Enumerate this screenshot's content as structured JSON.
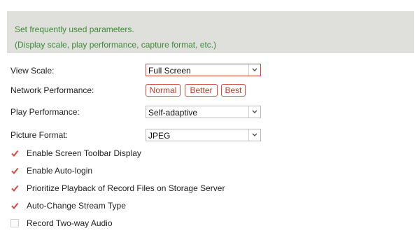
{
  "info": {
    "line1": "Set frequently used parameters.",
    "line2": "(Display scale, play performance, capture format, etc.)"
  },
  "view_scale": {
    "label": "View Scale:",
    "value": "Full Screen"
  },
  "network_performance": {
    "label": "Network Performance:",
    "options": [
      "Normal",
      "Better",
      "Best"
    ]
  },
  "play_performance": {
    "label": "Play Performance:",
    "value": "Self-adaptive"
  },
  "picture_format": {
    "label": "Picture Format:",
    "value": "JPEG"
  },
  "checkboxes": [
    {
      "label": "Enable Screen Toolbar Display",
      "checked": true
    },
    {
      "label": "Enable Auto-login",
      "checked": true
    },
    {
      "label": "Prioritize Playback of Record Files on Storage Server",
      "checked": true
    },
    {
      "label": "Auto-Change Stream Type",
      "checked": true
    },
    {
      "label": "Record Two-way Audio",
      "checked": false
    }
  ],
  "colors": {
    "accent": "#d34a3f",
    "info_text": "#3f8a3a",
    "info_bg": "#dfdfdb"
  }
}
